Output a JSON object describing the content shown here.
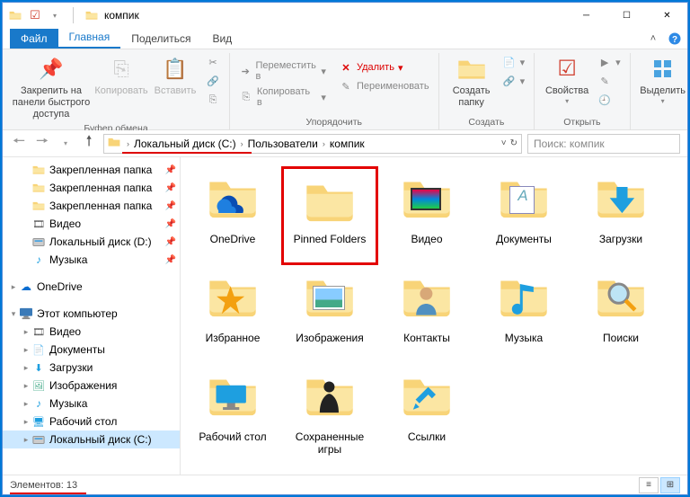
{
  "titlebar": {
    "title": "компик"
  },
  "tabs": {
    "file": "Файл",
    "home": "Главная",
    "share": "Поделиться",
    "view": "Вид"
  },
  "ribbon": {
    "clipboard": {
      "pin": "Закрепить на панели быстрого доступа",
      "copy": "Копировать",
      "paste": "Вставить",
      "label": "Буфер обмена"
    },
    "organize": {
      "move_to": "Переместить в",
      "copy_to": "Копировать в",
      "delete": "Удалить",
      "rename": "Переименовать",
      "label": "Упорядочить"
    },
    "new": {
      "new_folder": "Создать папку",
      "label": "Создать"
    },
    "open": {
      "properties": "Свойства",
      "label": "Открыть"
    },
    "select": {
      "select": "Выделить",
      "label": ""
    }
  },
  "breadcrumb": {
    "parts": [
      "Локальный диск (C:)",
      "Пользователи",
      "компик"
    ]
  },
  "search": {
    "placeholder": "Поиск: компик"
  },
  "tree": {
    "items": [
      {
        "label": "Закрепленная папка",
        "icon": "folder",
        "indent": 20,
        "pin": true
      },
      {
        "label": "Закрепленная папка",
        "icon": "folder",
        "indent": 20,
        "pin": true
      },
      {
        "label": "Закрепленная папка",
        "icon": "folder",
        "indent": 20,
        "pin": true
      },
      {
        "label": "Видео",
        "icon": "video",
        "indent": 20,
        "pin": true
      },
      {
        "label": "Локальный диск (D:)",
        "icon": "disk",
        "indent": 20,
        "pin": true
      },
      {
        "label": "Музыка",
        "icon": "music",
        "indent": 20,
        "pin": true
      },
      {
        "spacer": true
      },
      {
        "label": "OneDrive",
        "icon": "onedrive",
        "indent": 6,
        "twisty": "▸"
      },
      {
        "spacer": true
      },
      {
        "label": "Этот компьютер",
        "icon": "pc",
        "indent": 6,
        "twisty": "▾"
      },
      {
        "label": "Видео",
        "icon": "video",
        "indent": 20,
        "twisty": "▸"
      },
      {
        "label": "Документы",
        "icon": "docs",
        "indent": 20,
        "twisty": "▸"
      },
      {
        "label": "Загрузки",
        "icon": "downloads",
        "indent": 20,
        "twisty": "▸"
      },
      {
        "label": "Изображения",
        "icon": "pictures",
        "indent": 20,
        "twisty": "▸"
      },
      {
        "label": "Музыка",
        "icon": "music",
        "indent": 20,
        "twisty": "▸"
      },
      {
        "label": "Рабочий стол",
        "icon": "desktop",
        "indent": 20,
        "twisty": "▸"
      },
      {
        "label": "Локальный диск (C:)",
        "icon": "disk",
        "indent": 20,
        "twisty": "▸",
        "selected": true
      }
    ]
  },
  "grid": {
    "items": [
      {
        "label": "OneDrive",
        "icon": "onedrive"
      },
      {
        "label": "Pinned Folders",
        "icon": "folder",
        "highlight": true
      },
      {
        "label": "Видео",
        "icon": "video"
      },
      {
        "label": "Документы",
        "icon": "docs"
      },
      {
        "label": "Загрузки",
        "icon": "downloads"
      },
      {
        "label": "Избранное",
        "icon": "favorites"
      },
      {
        "label": "Изображения",
        "icon": "pictures"
      },
      {
        "label": "Контакты",
        "icon": "contacts"
      },
      {
        "label": "Музыка",
        "icon": "music"
      },
      {
        "label": "Поиски",
        "icon": "search"
      },
      {
        "label": "Рабочий стол",
        "icon": "desktop"
      },
      {
        "label": "Сохраненные игры",
        "icon": "games"
      },
      {
        "label": "Ссылки",
        "icon": "links"
      }
    ]
  },
  "statusbar": {
    "count_label": "Элементов: 13"
  }
}
